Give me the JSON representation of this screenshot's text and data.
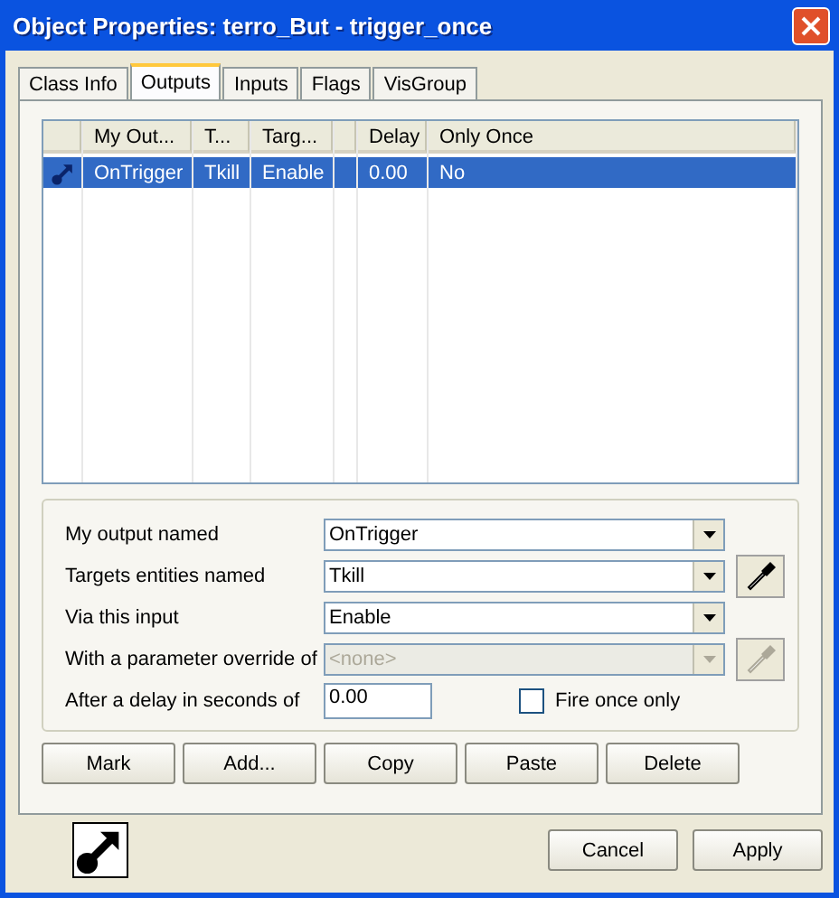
{
  "window": {
    "title": "Object Properties: terro_But - trigger_once"
  },
  "tabs": [
    {
      "label": "Class Info",
      "selected": false
    },
    {
      "label": "Outputs",
      "selected": true
    },
    {
      "label": "Inputs",
      "selected": false
    },
    {
      "label": "Flags",
      "selected": false
    },
    {
      "label": "VisGroup",
      "selected": false
    }
  ],
  "table": {
    "columns": [
      "My Out...",
      "T...",
      "Targ...",
      "Delay",
      "Only Once"
    ],
    "rows": [
      {
        "selected": true,
        "cells": [
          "OnTrigger",
          "Tkill",
          "Enable",
          "0.00",
          "No"
        ]
      }
    ]
  },
  "form": {
    "fields": [
      {
        "label": "My output named",
        "kind": "combo",
        "value": "OnTrigger",
        "disabled": false,
        "picker": false
      },
      {
        "label": "Targets entities named",
        "kind": "combo",
        "value": "Tkill",
        "disabled": false,
        "picker": true
      },
      {
        "label": "Via this input",
        "kind": "combo",
        "value": "Enable",
        "disabled": false,
        "picker": false
      },
      {
        "label": "With a parameter override of",
        "kind": "combo",
        "value": "<none>",
        "disabled": true,
        "picker": true
      },
      {
        "label": "After a delay in seconds of",
        "kind": "text",
        "value": "0.00",
        "disabled": false,
        "picker": false
      }
    ],
    "checkbox": {
      "label": "Fire once only",
      "checked": false
    }
  },
  "actions": [
    "Mark",
    "Add...",
    "Copy",
    "Paste",
    "Delete"
  ],
  "footer_buttons": [
    "Cancel",
    "Apply"
  ]
}
